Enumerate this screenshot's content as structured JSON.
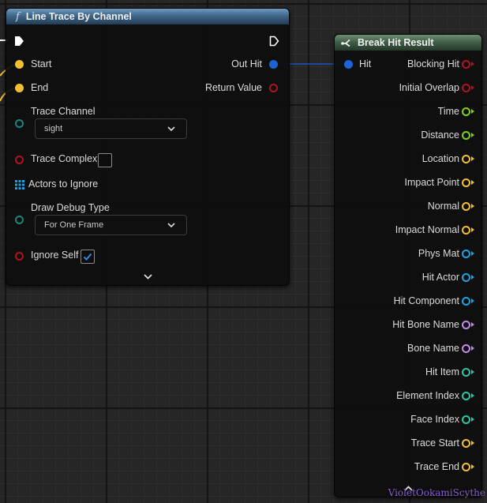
{
  "colors": {
    "exec": "#ffffff",
    "vector": "#f4c030",
    "struct": "#1b63d6",
    "bool": "#b0151d",
    "float": "#7ed321",
    "object": "#1ba3e6",
    "name": "#c58bea",
    "int": "#2fc6a8",
    "byte": "#168778",
    "wire": "#1a55c8",
    "watermark": "#8a5fd3"
  },
  "line_trace": {
    "title": "Line Trace By Channel",
    "function_glyph": "f",
    "title_icon": "function-icon",
    "inputs": {
      "start": "Start",
      "end": "End",
      "trace_channel": "Trace Channel",
      "trace_channel_value": "sight",
      "trace_complex": "Trace Complex",
      "trace_complex_checked": false,
      "actors_to_ignore": "Actors to Ignore",
      "draw_debug_type": "Draw Debug Type",
      "draw_debug_value": "For One Frame",
      "ignore_self": "Ignore Self",
      "ignore_self_checked": true
    },
    "outputs": {
      "out_hit": "Out Hit",
      "return_value": "Return Value"
    }
  },
  "break_hit": {
    "title": "Break Hit Result",
    "title_icon": "break-struct-icon",
    "input": "Hit",
    "outputs": [
      {
        "label": "Blocking Hit",
        "pin": "bool"
      },
      {
        "label": "Initial Overlap",
        "pin": "bool"
      },
      {
        "label": "Time",
        "pin": "float"
      },
      {
        "label": "Distance",
        "pin": "float"
      },
      {
        "label": "Location",
        "pin": "vector"
      },
      {
        "label": "Impact Point",
        "pin": "vector"
      },
      {
        "label": "Normal",
        "pin": "vector"
      },
      {
        "label": "Impact Normal",
        "pin": "vector"
      },
      {
        "label": "Phys Mat",
        "pin": "object"
      },
      {
        "label": "Hit Actor",
        "pin": "object"
      },
      {
        "label": "Hit Component",
        "pin": "object"
      },
      {
        "label": "Hit Bone Name",
        "pin": "name"
      },
      {
        "label": "Bone Name",
        "pin": "name"
      },
      {
        "label": "Hit Item",
        "pin": "int"
      },
      {
        "label": "Element Index",
        "pin": "int"
      },
      {
        "label": "Face Index",
        "pin": "int"
      },
      {
        "label": "Trace Start",
        "pin": "vector"
      },
      {
        "label": "Trace End",
        "pin": "vector"
      }
    ]
  },
  "watermark": "VioletOokamiScythe"
}
